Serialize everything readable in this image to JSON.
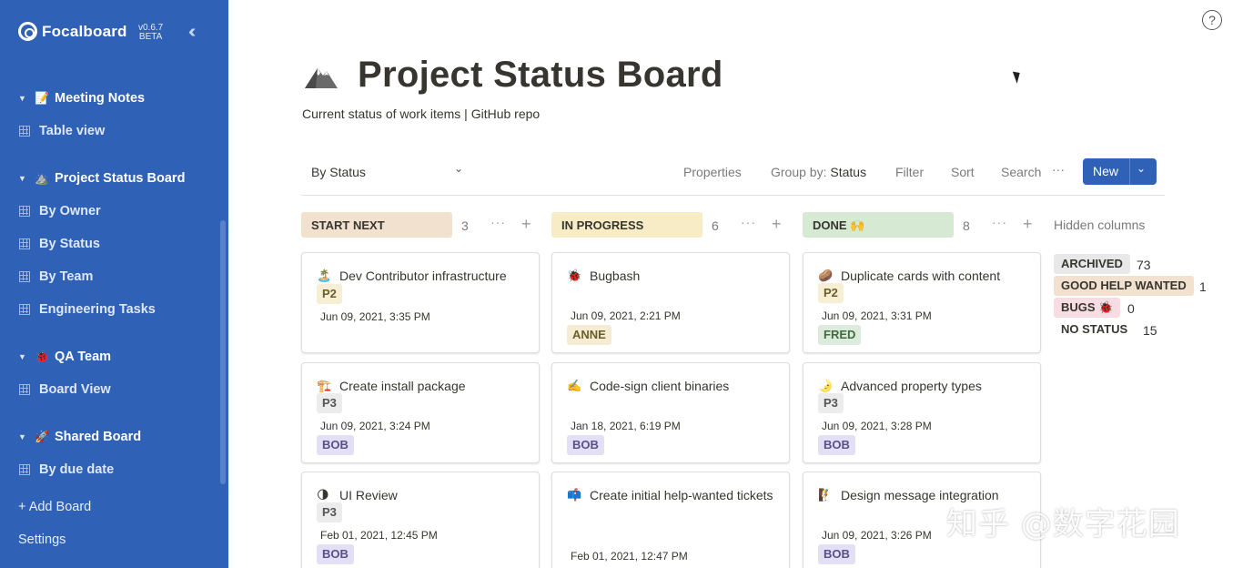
{
  "sidebar": {
    "app_name": "Focalboard",
    "version": "v0.6.7",
    "version_tag": "BETA",
    "collapse_icon": "double-chevron-left-icon",
    "boards": [
      {
        "emoji": "📝",
        "title": "Meeting Notes",
        "views": [
          "Table view"
        ]
      },
      {
        "emoji": "⛰️",
        "title": "Project Status Board",
        "views": [
          "By Owner",
          "By Status",
          "By Team",
          "Engineering Tasks"
        ]
      },
      {
        "emoji": "🐞",
        "title": "QA Team",
        "views": [
          "Board View"
        ]
      },
      {
        "emoji": "🚀",
        "title": "Shared Board",
        "views": [
          "By due date"
        ]
      }
    ],
    "add_board": "+ Add Board",
    "settings": "Settings"
  },
  "header": {
    "title": "Project Status Board",
    "description": "Current status of work items | GitHub repo"
  },
  "toolbar": {
    "view_name": "By Status",
    "properties": "Properties",
    "group_by_label": "Group by:",
    "group_by_value": "Status",
    "filter": "Filter",
    "sort": "Sort",
    "search": "Search",
    "more": "···",
    "new_label": "New"
  },
  "columns": [
    {
      "label": "START NEXT",
      "count": "3",
      "color": "#f3e1cf",
      "cards": [
        {
          "emoji": "🏝️",
          "title": "Dev Contributor infrastructure",
          "priority": "P2",
          "date": "Jun 09, 2021, 3:35 PM",
          "person": ""
        },
        {
          "emoji": "🏗️",
          "title": "Create install package",
          "priority": "P3",
          "date": "Jun 09, 2021, 3:24 PM",
          "person": "BOB"
        },
        {
          "emoji": "🌗",
          "title": "UI Review",
          "priority": "P3",
          "date": "Feb 01, 2021, 12:45 PM",
          "person": "BOB"
        }
      ]
    },
    {
      "label": "IN PROGRESS",
      "count": "6",
      "color": "#f7ecc6",
      "cards": [
        {
          "emoji": "🐞",
          "title": "Bugbash",
          "priority": "",
          "date": "Jun 09, 2021, 2:21 PM",
          "person": "ANNE"
        },
        {
          "emoji": "✍️",
          "title": "Code-sign client binaries",
          "priority": "",
          "date": "Jan 18, 2021, 6:19 PM",
          "person": "BOB"
        },
        {
          "emoji": "📫",
          "title": "Create initial help-wanted tickets",
          "priority": "",
          "date": "Feb 01, 2021, 12:47 PM",
          "person": ""
        }
      ]
    },
    {
      "label": "DONE 🙌",
      "count": "8",
      "color": "#d6ead3",
      "cards": [
        {
          "emoji": "🥔",
          "title": "Duplicate cards with content",
          "priority": "P2",
          "date": "Jun 09, 2021, 3:31 PM",
          "person": "FRED"
        },
        {
          "emoji": "🌛",
          "title": "Advanced property types",
          "priority": "P3",
          "date": "Jun 09, 2021, 3:28 PM",
          "person": "BOB"
        },
        {
          "emoji": "🧗",
          "title": "Design message integration",
          "priority": "",
          "date": "Jun 09, 2021, 3:26 PM",
          "person": "BOB"
        }
      ]
    }
  ],
  "hidden_columns": {
    "title": "Hidden columns",
    "items": [
      {
        "label": "ARCHIVED",
        "count": "73",
        "color": "#e8e8e8"
      },
      {
        "label": "GOOD HELP WANTED",
        "count": "1",
        "color": "#f3e1cf"
      },
      {
        "label": "BUGS 🐞",
        "count": "0",
        "color": "#f7dde3"
      },
      {
        "label": "NO STATUS",
        "count": "15",
        "color": "transparent"
      }
    ]
  },
  "watermark": "知乎 @数字花园",
  "colors": {
    "sidebar": "#2f61b7",
    "accent": "#2f61b7"
  }
}
